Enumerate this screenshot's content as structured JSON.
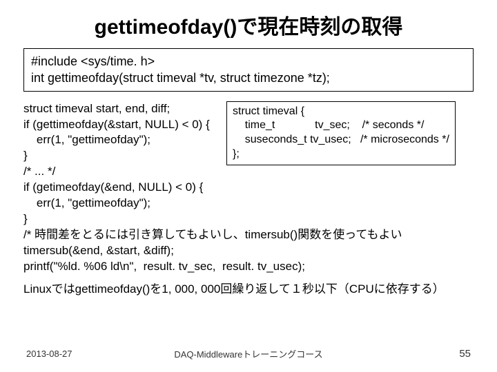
{
  "title": "gettimeofday()で現在時刻の取得",
  "signature": {
    "line1": "#include <sys/time. h>",
    "line2": "int gettimeofday(struct timeval *tv, struct timezone *tz);"
  },
  "struct_def": "struct timeval {\n    time_t             tv_sec;    /* seconds */\n    suseconds_t tv_usec;   /* microseconds */\n};",
  "code": "struct timeval start, end, diff;\nif (gettimeofday(&start, NULL) < 0) {\n    err(1, \"gettimeofday\");\n}\n/* ... */\nif (getimeofday(&end, NULL) < 0) {\n    err(1, \"gettimeofday\");\n}\n/* 時間差をとるには引き算してもよいし、timersub()関数を使ってもよい\ntimersub(&end, &start, &diff);\nprintf(\"%ld. %06 ld\\n\",  result. tv_sec,  result. tv_usec);",
  "note": "Linuxではgettimeofday()を1, 000, 000回繰り返して１秒以下（CPUに依存する）",
  "footer": {
    "date": "2013-08-27",
    "course": "DAQ-Middlewareトレーニングコース",
    "page": "55"
  }
}
